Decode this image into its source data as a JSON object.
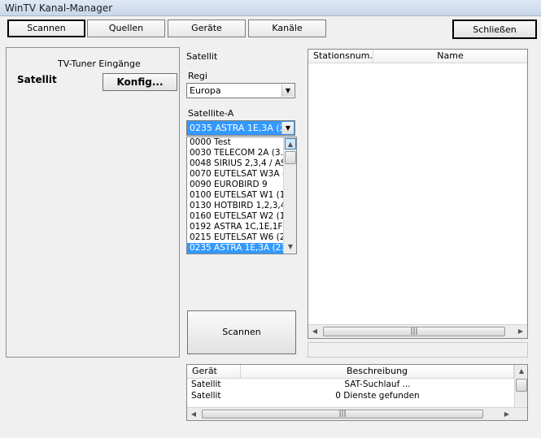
{
  "window": {
    "title": "WinTV Kanal-Manager"
  },
  "tabs": [
    {
      "label": "Scannen"
    },
    {
      "label": "Quellen"
    },
    {
      "label": "Geräte"
    },
    {
      "label": "Kanäle"
    }
  ],
  "close_button": "Schließen",
  "left_panel": {
    "heading": "TV-Tuner Eingänge",
    "source_label": "Satellit",
    "config_button": "Konfig..."
  },
  "mid": {
    "section_label": "Satellit",
    "region_label": "Regi",
    "region_value": "Europa",
    "satellite_label": "Satellite-A",
    "satellite_value": "0235 ASTRA 1E,3A (23",
    "satellite_list": [
      "0000 Test",
      "0030 TELECOM 2A (3.0",
      "0048 SIRIUS 2,3,4 / AS",
      "0070 EUTELSAT W3A (",
      "0090 EUROBIRD 9",
      "0100 EUTELSAT W1 (1",
      "0130 HOTBIRD 1,2,3,4,",
      "0160 EUTELSAT W2 (1",
      "0192 ASTRA 1C,1E,1F,1",
      "0215 EUTELSAT W6 (2",
      "0235 ASTRA 1E,3A (23"
    ],
    "selected_index": 10,
    "scan_button": "Scannen"
  },
  "stations_table": {
    "columns": [
      "Stationsnum...",
      "Name"
    ]
  },
  "log_table": {
    "columns": [
      "Gerät",
      "Beschreibung"
    ],
    "rows": [
      {
        "device": "Satellit",
        "description": "SAT-Suchlauf ..."
      },
      {
        "device": "Satellit",
        "description": "0 Dienste gefunden"
      }
    ]
  },
  "icons": {
    "dropdown": "chevron-down-icon",
    "scroll_up": "arrow-up-icon",
    "scroll_down": "arrow-down-icon",
    "scroll_left": "arrow-left-icon",
    "scroll_right": "arrow-right-icon"
  },
  "colors": {
    "selection": "#3399ff"
  }
}
